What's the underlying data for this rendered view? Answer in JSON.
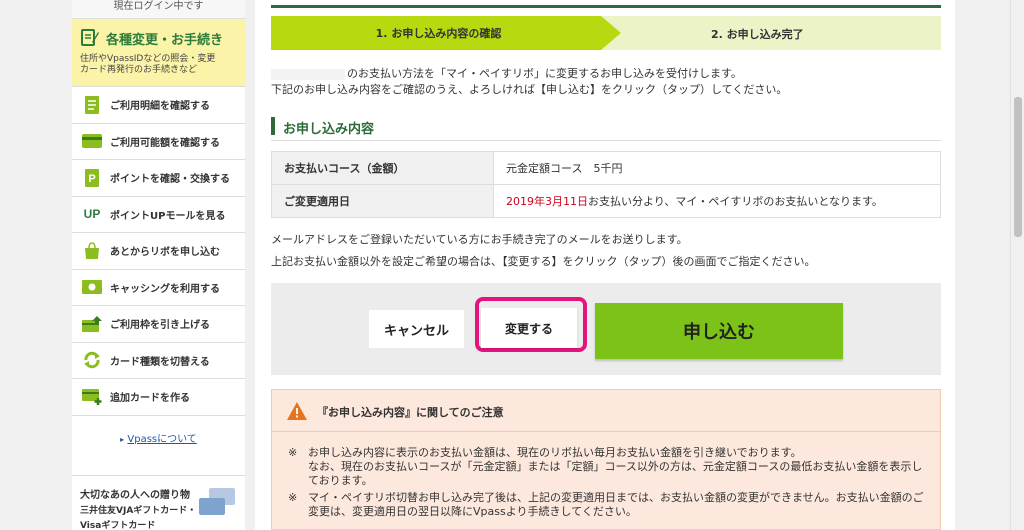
{
  "sidebar": {
    "login_status": "現在ログイン中です",
    "settings_title": "各種変更・お手続き",
    "settings_sub": "住所やVpassIDなどの照会・変更\nカード再発行のお手続きなど",
    "menu": [
      {
        "label": "ご利用明細を確認する",
        "icon": "statement-icon"
      },
      {
        "label": "ご利用可能額を確認する",
        "icon": "credit-card-icon"
      },
      {
        "label": "ポイントを確認・交換する",
        "icon": "point-icon"
      },
      {
        "label": "ポイントUPモールを見る",
        "icon_text": "UP",
        "icon": "up-mall-icon"
      },
      {
        "label": "あとからリボを申し込む",
        "icon": "shopping-bag-icon"
      },
      {
        "label": "キャッシングを利用する",
        "icon": "cashing-icon"
      },
      {
        "label": "ご利用枠を引き上げる",
        "icon": "limit-up-icon"
      },
      {
        "label": "カード種類を切替える",
        "icon": "switch-card-icon"
      },
      {
        "label": "追加カードを作る",
        "icon": "add-card-icon"
      }
    ],
    "vpass_link_label": "Vpassについて",
    "banner": {
      "line1": "大切なあの人への贈り物",
      "line2": "三井住友VJAギフトカード・",
      "line3": "Visaギフトカード"
    }
  },
  "steps": {
    "step1": "1. お申し込み内容の確認",
    "step2": "2. お申し込み完了"
  },
  "intro": {
    "line1": "のお支払い方法を「マイ・ペイすリボ」に変更するお申し込みを受付けします。",
    "line2": "下記のお申し込み内容をご確認のうえ、よろしければ【申し込む】をクリック（タップ）してください。"
  },
  "section_title": "お申し込み内容",
  "details": {
    "course_label": "お支払いコース（金額）",
    "course_value": "元金定額コース　5千円",
    "date_label": "ご変更適用日",
    "date_value": "2019年3月11日",
    "date_suffix": "お支払い分より、マイ・ペイすリボのお支払いとなります。"
  },
  "notes": {
    "line1": "メールアドレスをご登録いただいている方にお手続き完了のメールをお送りします。",
    "line2": "上記お支払い金額以外を設定ご希望の場合は、【変更する】をクリック（タップ）後の画面でご指定ください。"
  },
  "buttons": {
    "cancel": "キャンセル",
    "change": "変更する",
    "submit": "申し込む"
  },
  "caution": {
    "title": "『お申し込み内容』に関してのご注意",
    "mark": "※",
    "items": [
      "お申し込み内容に表示のお支払い金額は、現在のリボ払い毎月お支払い金額を引き継いでおります。\nなお、現在のお支払いコースが「元金定額」または「定額」コース以外の方は、元金定額コースの最低お支払い金額を表示しております。",
      "マイ・ペイすリボ切替お申し込み完了後は、上記の変更適用日までは、お支払い金額の変更ができません。お支払い金額のご変更は、変更適用日の翌日以降にVpassより手続きしてください。"
    ]
  },
  "colors": {
    "brand_green": "#2c6a3a",
    "step_active": "#b6d90f",
    "submit_green": "#7cc219",
    "highlight_pink": "#e5137d",
    "caution_bg": "#fde8dd",
    "date_red": "#d0021b"
  }
}
